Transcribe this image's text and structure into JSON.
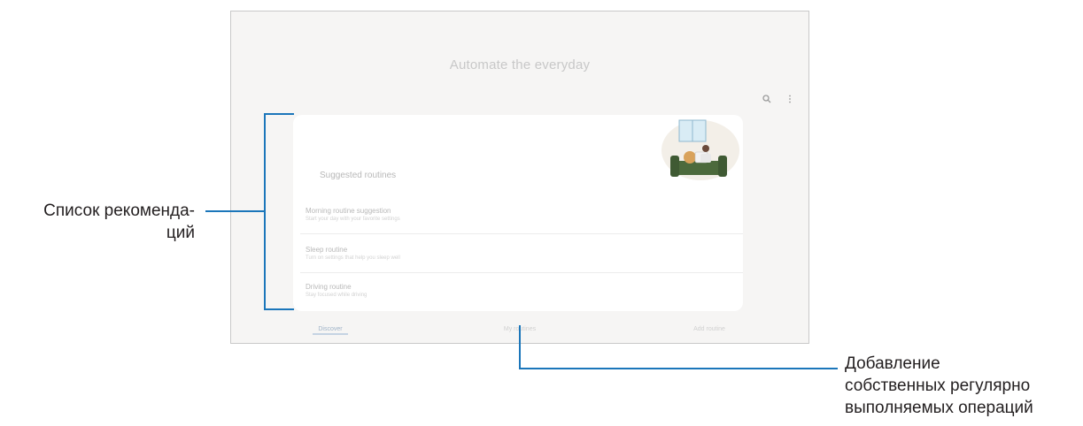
{
  "screen": {
    "title": "Automate the everyday",
    "toolbar": {
      "search_icon": "search-icon",
      "more_icon": "more-vert-icon"
    },
    "card": {
      "title": "Suggested routines",
      "items": [
        {
          "title": "Morning routine suggestion",
          "subtitle": "Start your day with your favorite settings"
        },
        {
          "title": "Sleep routine",
          "subtitle": "Turn on settings that help you sleep well"
        },
        {
          "title": "Driving routine",
          "subtitle": "Stay focused while driving"
        }
      ]
    },
    "tabs": [
      {
        "label": "Discover"
      },
      {
        "label": "My routines"
      },
      {
        "label": "Add routine"
      }
    ]
  },
  "callouts": {
    "left": {
      "line1": "Список рекоменда-",
      "line2": "ций"
    },
    "right": {
      "line1": "Добавление",
      "line2": "собственных регулярно",
      "line3": "выполняемых операций"
    }
  },
  "colors": {
    "accent_line": "#1b76ba"
  }
}
